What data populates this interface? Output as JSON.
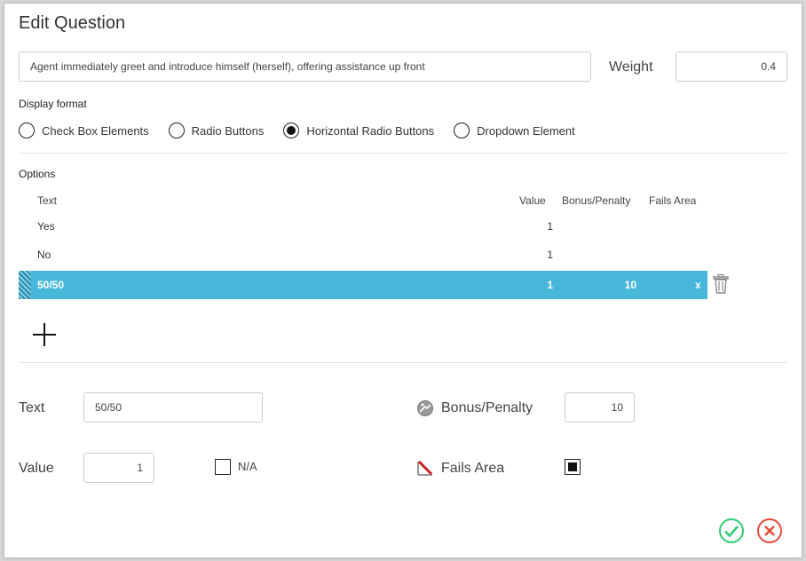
{
  "dialog": {
    "title": "Edit Question",
    "question_text": "Agent immediately greet and introduce himself (herself), offering assistance up front",
    "weight_label": "Weight",
    "weight_value": "0.4"
  },
  "display_format": {
    "label": "Display format",
    "options": [
      "Check Box Elements",
      "Radio Buttons",
      "Horizontal Radio Buttons",
      "Dropdown Element"
    ],
    "selected_index": 2
  },
  "options": {
    "label": "Options",
    "headers": {
      "text": "Text",
      "value": "Value",
      "bonus": "Bonus/Penalty",
      "fails": "Fails Area"
    },
    "rows": [
      {
        "text": "Yes",
        "value": "1",
        "bonus": "",
        "fails": ""
      },
      {
        "text": "No",
        "value": "1",
        "bonus": "",
        "fails": ""
      },
      {
        "text": "50/50",
        "value": "1",
        "bonus": "10",
        "fails": "x"
      }
    ]
  },
  "editor": {
    "text_label": "Text",
    "text_value": "50/50",
    "value_label": "Value",
    "value_value": "1",
    "na_label": "N/A",
    "na_checked": false,
    "bonus_label": "Bonus/Penalty",
    "bonus_value": "10",
    "fails_label": "Fails Area",
    "fails_checked": true
  },
  "colors": {
    "selected_row": "#47b7da",
    "confirm": "#2ecc71",
    "cancel": "#e74c3c"
  },
  "icons": [
    "trash-icon",
    "plus-icon",
    "bonus-penalty-icon",
    "fails-area-icon",
    "check-circle-icon",
    "cancel-circle-icon"
  ]
}
